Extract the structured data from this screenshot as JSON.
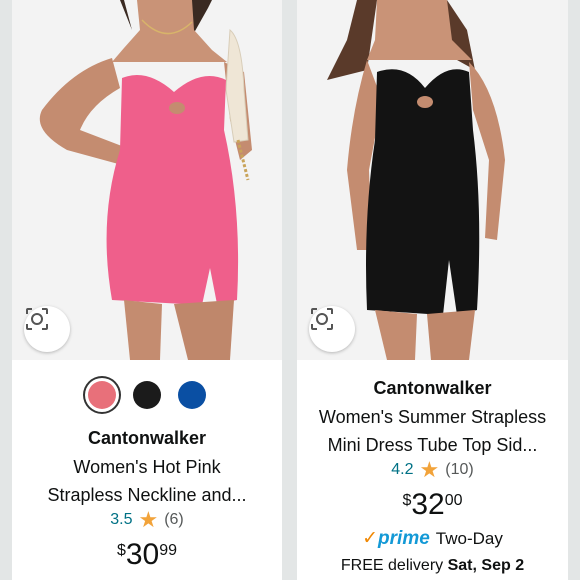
{
  "products": [
    {
      "brand": "Cantonwalker",
      "title_line1": "Women's Hot Pink",
      "title_line2": "Strapless Neckline and...",
      "rating": "3.5",
      "review_count": "(6)",
      "price_symbol": "$",
      "price_dollars": "30",
      "price_cents": "99",
      "image": "pink strapless mini dress",
      "swatches": [
        {
          "color": "#e8707a",
          "selected": true
        },
        {
          "color": "#1b1b1b",
          "selected": false
        },
        {
          "color": "#0a4fa3",
          "selected": false
        }
      ]
    },
    {
      "brand": "Cantonwalker",
      "title_line1": "Women's Summer Strapless",
      "title_line2": "Mini Dress Tube Top Sid...",
      "rating": "4.2",
      "review_count": "(10)",
      "price_symbol": "$",
      "price_dollars": "32",
      "price_cents": "00",
      "image": "black strapless mini dress",
      "prime_label": "prime",
      "prime_extra": "Two-Day",
      "delivery_prefix": "FREE delivery",
      "delivery_date": "Sat, Sep 2"
    }
  ],
  "star_glyph": "★",
  "colors": {
    "link": "#007185",
    "star": "#f2a33a",
    "prime": "#1399d6",
    "background": "#e3e6e6"
  }
}
